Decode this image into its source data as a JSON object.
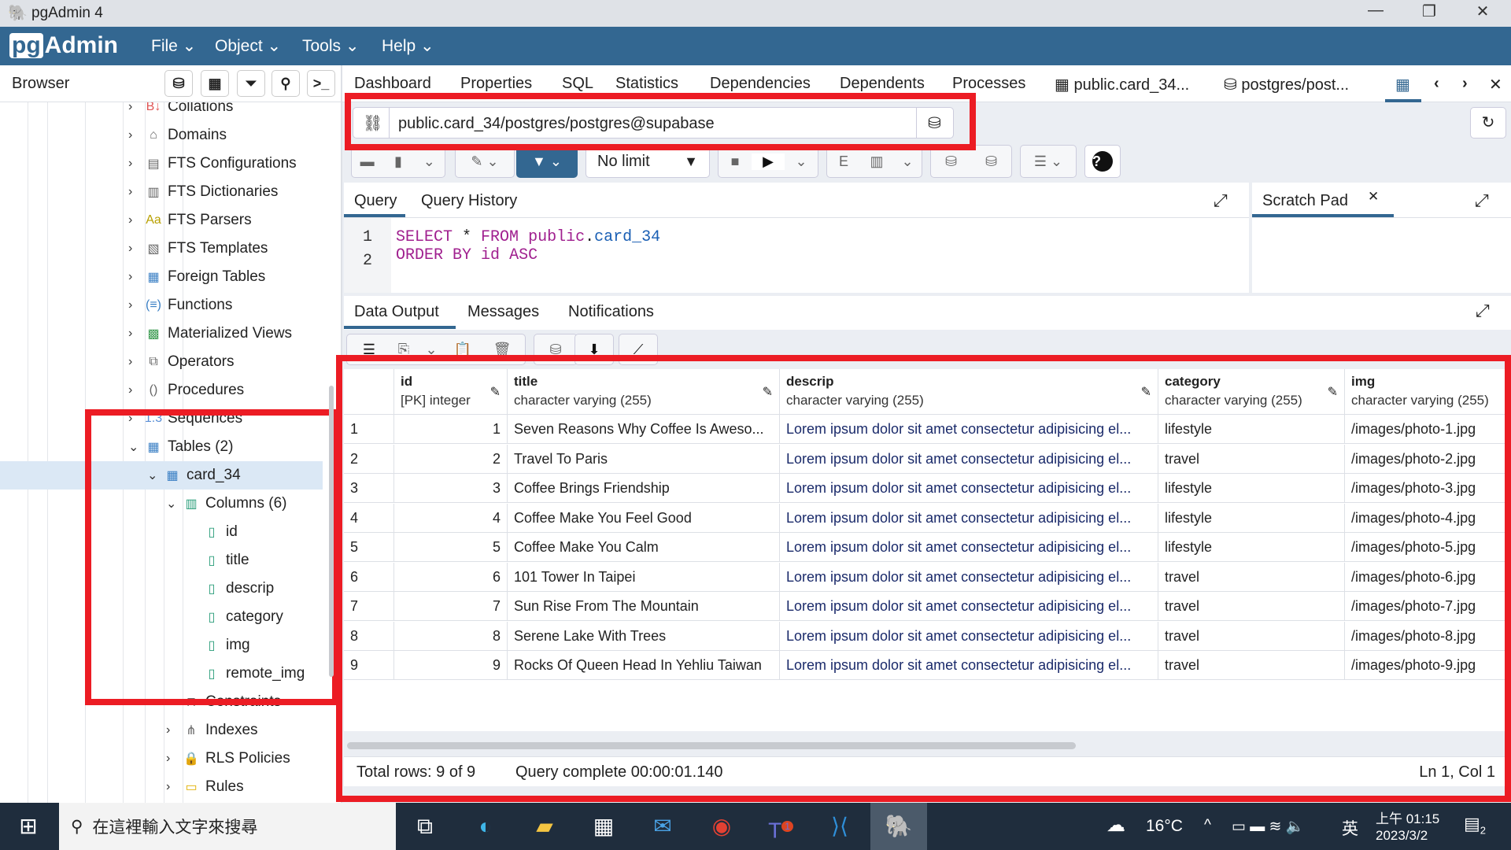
{
  "window": {
    "title": "pgAdmin 4"
  },
  "menu": {
    "logo": "pgAdmin",
    "items": [
      "File",
      "Object",
      "Tools",
      "Help"
    ]
  },
  "browser": {
    "title": "Browser",
    "tree": [
      {
        "label": "Collations",
        "level": 1,
        "icon": "collation-icon"
      },
      {
        "label": "Domains",
        "level": 1,
        "icon": "domain-icon"
      },
      {
        "label": "FTS Configurations",
        "level": 1,
        "icon": "fts-config-icon"
      },
      {
        "label": "FTS Dictionaries",
        "level": 1,
        "icon": "fts-dictionary-icon"
      },
      {
        "label": "FTS Parsers",
        "level": 1,
        "icon": "fts-parser-icon"
      },
      {
        "label": "FTS Templates",
        "level": 1,
        "icon": "fts-template-icon"
      },
      {
        "label": "Foreign Tables",
        "level": 1,
        "icon": "foreign-table-icon"
      },
      {
        "label": "Functions",
        "level": 1,
        "icon": "function-icon"
      },
      {
        "label": "Materialized Views",
        "level": 1,
        "icon": "mview-icon"
      },
      {
        "label": "Operators",
        "level": 1,
        "icon": "operator-icon"
      },
      {
        "label": "Procedures",
        "level": 1,
        "icon": "procedure-icon"
      },
      {
        "label": "Sequences",
        "level": 1,
        "icon": "sequence-icon"
      },
      {
        "label": "Tables (2)",
        "level": 1,
        "icon": "table-icon",
        "expanded": true
      },
      {
        "label": "card_34",
        "level": 2,
        "icon": "table-icon",
        "expanded": true,
        "selected": true
      },
      {
        "label": "Columns (6)",
        "level": 3,
        "icon": "columns-icon",
        "expanded": true
      },
      {
        "label": "id",
        "level": 4,
        "icon": "column-icon"
      },
      {
        "label": "title",
        "level": 4,
        "icon": "column-icon"
      },
      {
        "label": "descrip",
        "level": 4,
        "icon": "column-icon"
      },
      {
        "label": "category",
        "level": 4,
        "icon": "column-icon"
      },
      {
        "label": "img",
        "level": 4,
        "icon": "column-icon"
      },
      {
        "label": "remote_img",
        "level": 4,
        "icon": "column-icon"
      },
      {
        "label": "Constraints",
        "level": 3,
        "icon": "constraint-icon"
      },
      {
        "label": "Indexes",
        "level": 3,
        "icon": "index-icon"
      },
      {
        "label": "RLS Policies",
        "level": 3,
        "icon": "policy-icon"
      },
      {
        "label": "Rules",
        "level": 3,
        "icon": "rule-icon"
      }
    ]
  },
  "tabs": [
    "Dashboard",
    "Properties",
    "SQL",
    "Statistics",
    "Dependencies",
    "Dependents",
    "Processes",
    "public.card_34...",
    "postgres/post..."
  ],
  "connection": "public.card_34/postgres/postgres@supabase",
  "toolbar": {
    "limit": "No limit"
  },
  "query": {
    "tabs": [
      "Query",
      "Query History"
    ],
    "scratch": "Scratch Pad",
    "lines": [
      "1",
      "2"
    ]
  },
  "output": {
    "tabs": [
      "Data Output",
      "Messages",
      "Notifications"
    ]
  },
  "grid": {
    "columns": [
      {
        "name": "id",
        "type": "[PK] integer"
      },
      {
        "name": "title",
        "type": "character varying (255)"
      },
      {
        "name": "descrip",
        "type": "character varying (255)"
      },
      {
        "name": "category",
        "type": "character varying (255)"
      },
      {
        "name": "img",
        "type": "character varying (255)"
      }
    ],
    "rows": [
      [
        "1",
        "1",
        "Seven Reasons Why Coffee Is Aweso...",
        "Lorem ipsum dolor sit amet consectetur adipisicing el...",
        "lifestyle",
        "/images/photo-1.jpg"
      ],
      [
        "2",
        "2",
        "Travel To Paris",
        "Lorem ipsum dolor sit amet consectetur adipisicing el...",
        "travel",
        "/images/photo-2.jpg"
      ],
      [
        "3",
        "3",
        "Coffee Brings Friendship",
        "Lorem ipsum dolor sit amet consectetur adipisicing el...",
        "lifestyle",
        "/images/photo-3.jpg"
      ],
      [
        "4",
        "4",
        "Coffee Make You Feel Good",
        "Lorem ipsum dolor sit amet consectetur adipisicing el...",
        "lifestyle",
        "/images/photo-4.jpg"
      ],
      [
        "5",
        "5",
        "Coffee Make You Calm",
        "Lorem ipsum dolor sit amet consectetur adipisicing el...",
        "lifestyle",
        "/images/photo-5.jpg"
      ],
      [
        "6",
        "6",
        "101 Tower In Taipei",
        "Lorem ipsum dolor sit amet consectetur adipisicing el...",
        "travel",
        "/images/photo-6.jpg"
      ],
      [
        "7",
        "7",
        "Sun Rise From The Mountain",
        "Lorem ipsum dolor sit amet consectetur adipisicing el...",
        "travel",
        "/images/photo-7.jpg"
      ],
      [
        "8",
        "8",
        "Serene Lake With Trees",
        "Lorem ipsum dolor sit amet consectetur adipisicing el...",
        "travel",
        "/images/photo-8.jpg"
      ],
      [
        "9",
        "9",
        "Rocks Of Queen Head In Yehliu Taiwan",
        "Lorem ipsum dolor sit amet consectetur adipisicing el...",
        "travel",
        "/images/photo-9.jpg"
      ]
    ]
  },
  "status": {
    "rows": "Total rows: 9 of 9",
    "query": "Query complete 00:00:01.140",
    "pos": "Ln 1, Col 1"
  },
  "taskbar": {
    "search": "在這裡輸入文字來搜尋",
    "temp": "16°C",
    "ime": "英",
    "time": "上午 01:15",
    "date": "2023/3/2",
    "notif": "2",
    "teams_badge": "1"
  }
}
